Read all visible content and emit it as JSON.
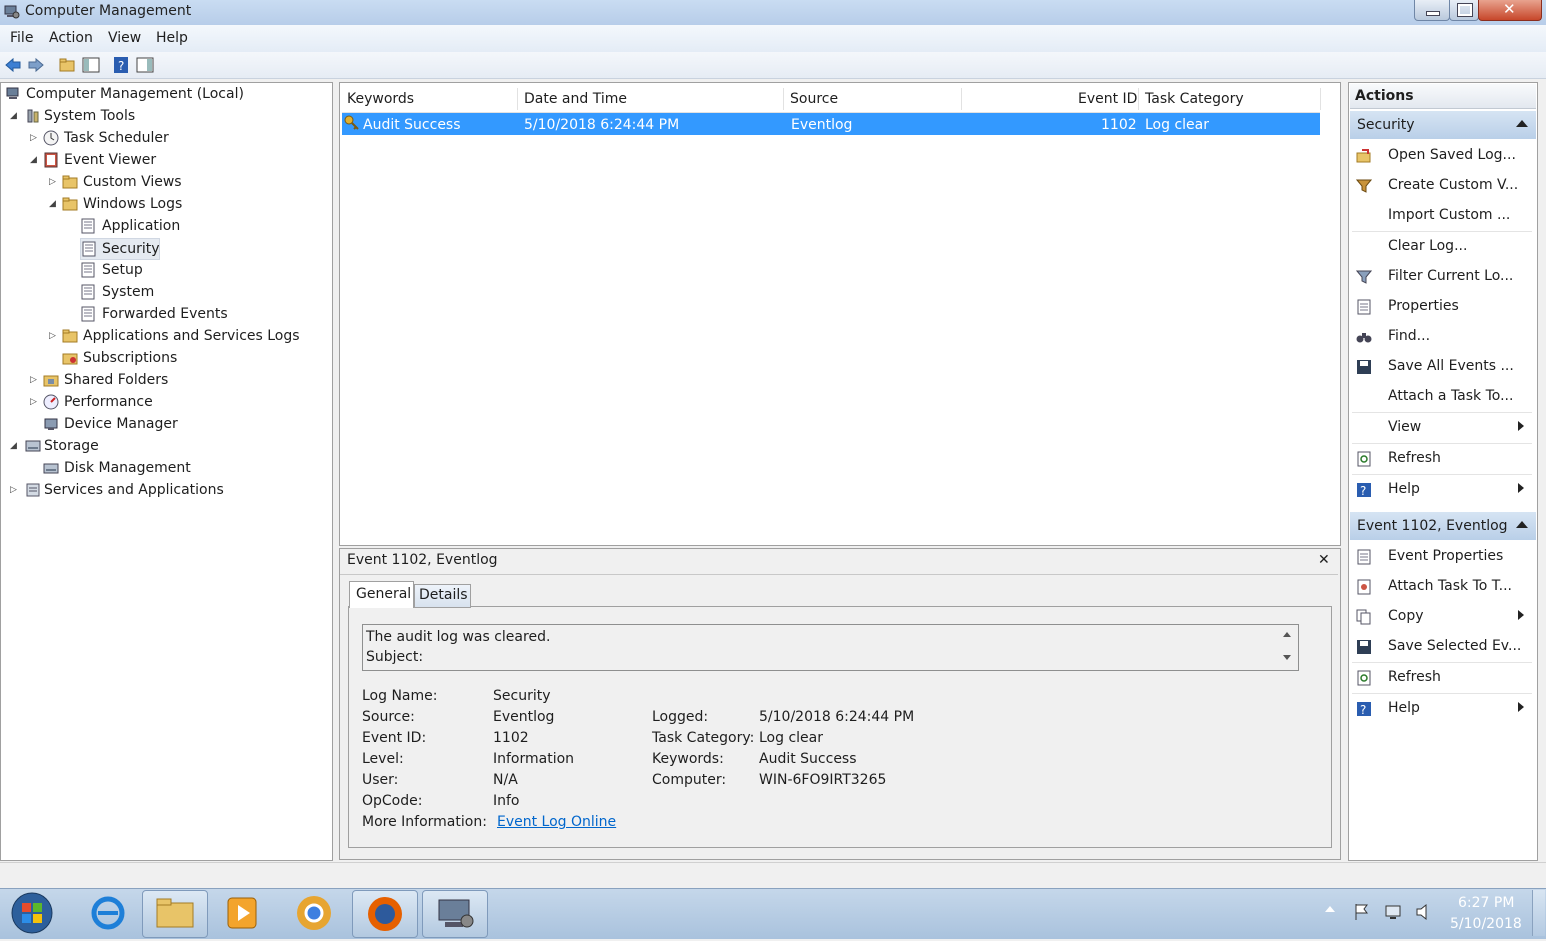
{
  "window": {
    "title": "Computer Management"
  },
  "menu": [
    "File",
    "Action",
    "View",
    "Help"
  ],
  "tree": {
    "root": "Computer Management (Local)",
    "system_tools": "System Tools",
    "task_scheduler": "Task Scheduler",
    "event_viewer": "Event Viewer",
    "custom_views": "Custom Views",
    "windows_logs": "Windows Logs",
    "application": "Application",
    "security": "Security",
    "setup": "Setup",
    "system": "System",
    "forwarded_events": "Forwarded Events",
    "apps_services_logs": "Applications and Services Logs",
    "subscriptions": "Subscriptions",
    "shared_folders": "Shared Folders",
    "performance": "Performance",
    "device_manager": "Device Manager",
    "storage": "Storage",
    "disk_management": "Disk Management",
    "services_apps": "Services and Applications"
  },
  "event_list": {
    "columns": [
      "Keywords",
      "Date and Time",
      "Source",
      "Event ID",
      "Task Category"
    ],
    "rows": [
      {
        "keywords": "Audit Success",
        "datetime": "5/10/2018 6:24:44 PM",
        "source": "Eventlog",
        "event_id": "1102",
        "task_category": "Log clear"
      }
    ]
  },
  "detail": {
    "header": "Event 1102, Eventlog",
    "close_glyph": "✕",
    "tabs": [
      "General",
      "Details"
    ],
    "description_line1": "The audit log was cleared.",
    "description_line2": "Subject:",
    "labels": {
      "log_name": "Log Name:",
      "source": "Source:",
      "event_id": "Event ID:",
      "level": "Level:",
      "user": "User:",
      "opcode": "OpCode:",
      "more_info": "More Information:",
      "logged": "Logged:",
      "task_category": "Task Category:",
      "keywords": "Keywords:",
      "computer": "Computer:"
    },
    "values": {
      "log_name": "Security",
      "source": "Eventlog",
      "event_id": "1102",
      "level": "Information",
      "user": "N/A",
      "opcode": "Info",
      "more_info_link": "Event Log Online",
      "logged": "5/10/2018 6:24:44 PM",
      "task_category": "Log clear",
      "keywords": "Audit Success",
      "computer": "WIN-6FO9IRT3265"
    }
  },
  "actions": {
    "title": "Actions",
    "section1": "Security",
    "section1_items": [
      "Open Saved Log...",
      "Create Custom V...",
      "Import Custom ...",
      "Clear Log...",
      "Filter Current Lo...",
      "Properties",
      "Find...",
      "Save All Events ...",
      "Attach a Task To...",
      "View",
      "Refresh",
      "Help"
    ],
    "section2": "Event 1102, Eventlog",
    "section2_items": [
      "Event Properties",
      "Attach Task To T...",
      "Copy",
      "Save Selected Ev...",
      "Refresh",
      "Help"
    ]
  },
  "taskbar": {
    "time": "6:27 PM",
    "date": "5/10/2018"
  },
  "colors": {
    "selection": "#3399ff",
    "link": "#0066cc",
    "section_bg": "#c6d9ef"
  }
}
